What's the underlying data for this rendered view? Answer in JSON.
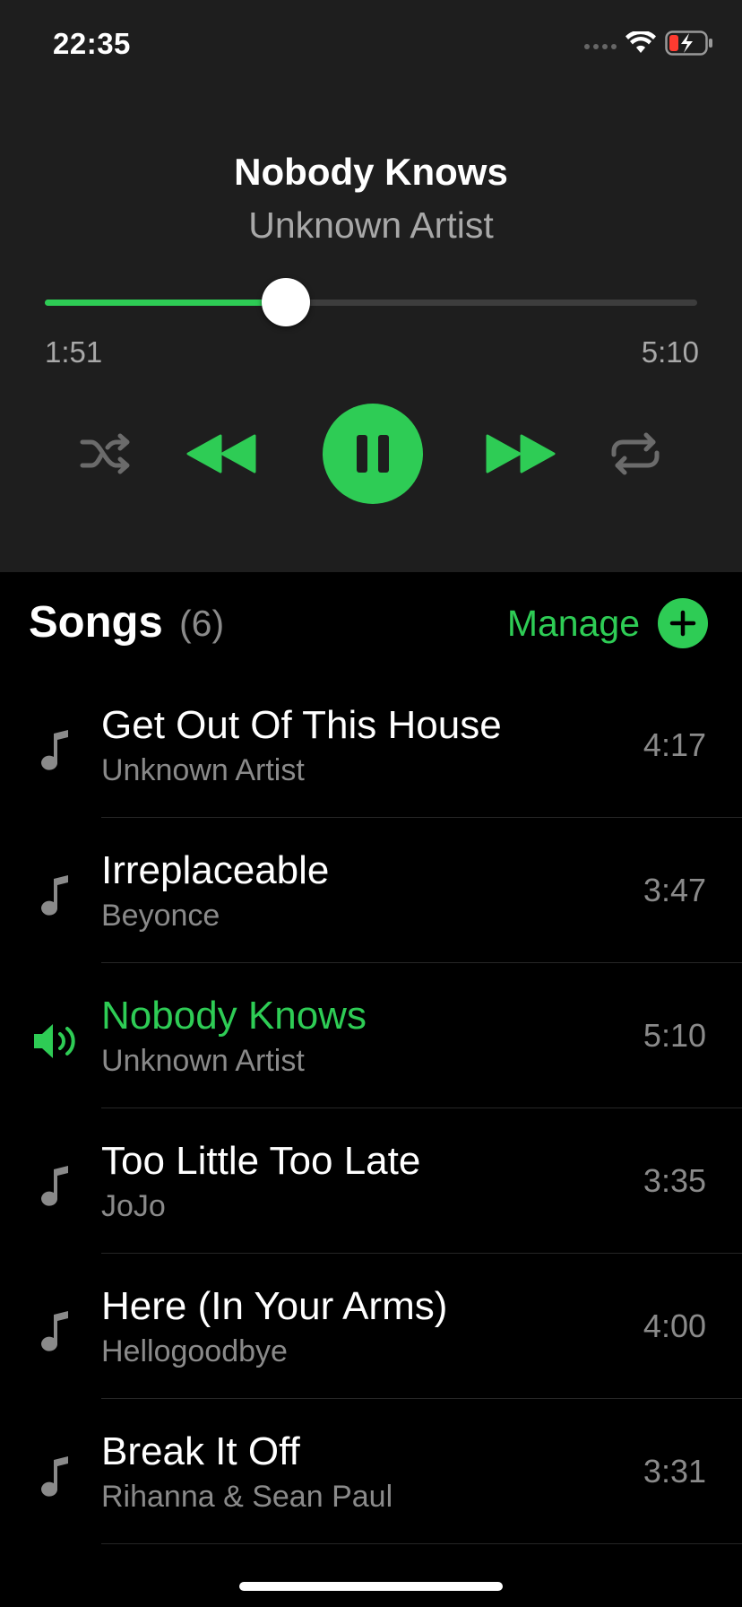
{
  "status_bar": {
    "time": "22:35",
    "icons": [
      "signal-dots-icon",
      "wifi-icon",
      "battery-charging-icon"
    ]
  },
  "now_playing": {
    "title": "Nobody Knows",
    "artist": "Unknown Artist",
    "elapsed": "1:51",
    "total": "5:10",
    "progress": 0.37,
    "controls": {
      "shuffle_icon": "shuffle-icon",
      "previous_icon": "rewind-icon",
      "play_pause_icon": "pause-icon",
      "next_icon": "fast-forward-icon",
      "repeat_icon": "repeat-icon"
    }
  },
  "songs": {
    "title": "Songs",
    "count": "(6)",
    "manage_label": "Manage",
    "add_icon": "plus-icon",
    "items": [
      {
        "title": "Get Out Of This House",
        "artist": "Unknown Artist",
        "duration": "4:17",
        "icon": "music-note-icon",
        "playing": false
      },
      {
        "title": "Irreplaceable",
        "artist": "Beyonce",
        "duration": "3:47",
        "icon": "music-note-icon",
        "playing": false
      },
      {
        "title": "Nobody Knows",
        "artist": "Unknown Artist",
        "duration": "5:10",
        "icon": "speaker-icon",
        "playing": true
      },
      {
        "title": "Too Little Too Late",
        "artist": "JoJo",
        "duration": "3:35",
        "icon": "music-note-icon",
        "playing": false
      },
      {
        "title": "Here (In Your Arms)",
        "artist": "Hellogoodbye",
        "duration": "4:00",
        "icon": "music-note-icon",
        "playing": false
      },
      {
        "title": "Break It Off",
        "artist": "Rihanna & Sean Paul",
        "duration": "3:31",
        "icon": "music-note-icon",
        "playing": false
      }
    ]
  },
  "colors": {
    "accent": "#2ecc55",
    "panel": "#1e1e1e",
    "background": "#000000",
    "secondary_text": "#8a8a8a"
  }
}
